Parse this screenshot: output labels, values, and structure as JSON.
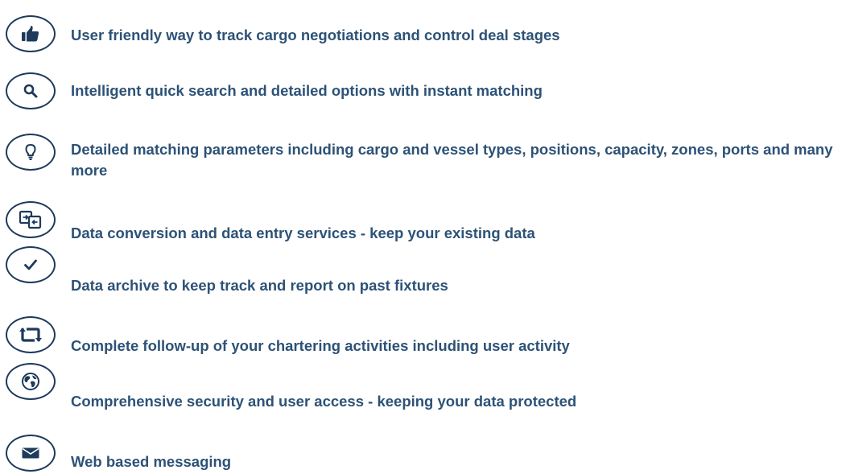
{
  "colors": {
    "text": "#2d5276",
    "icon": "#1e3a5c",
    "background": "#ffffff"
  },
  "features": [
    {
      "icon": "thumbs-up-icon",
      "text": "User friendly way to track cargo negotiations and control deal stages"
    },
    {
      "icon": "search-icon",
      "text": "Intelligent quick search and detailed options with instant matching"
    },
    {
      "icon": "lightbulb-icon",
      "text": "Detailed matching parameters including cargo and vessel types, positions, capacity, zones, ports and many more"
    },
    {
      "icon": "data-conversion-icon",
      "text": "Data conversion and data entry services - keep your existing data"
    },
    {
      "icon": "checkmark-icon",
      "text": "Data archive to keep track and report on past fixtures"
    },
    {
      "icon": "retweet-icon",
      "text": "Complete follow-up of your chartering activities including user activity"
    },
    {
      "icon": "globe-icon",
      "text": "Comprehensive security and user access - keeping your data protected"
    },
    {
      "icon": "envelope-icon",
      "text": "Web based messaging"
    }
  ]
}
